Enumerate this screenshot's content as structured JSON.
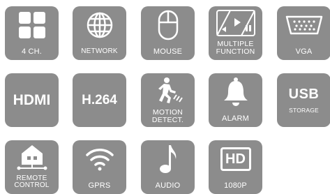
{
  "icons": {
    "four_ch": {
      "label": "4 CH.",
      "icon": "quad-grid-icon"
    },
    "network": {
      "label": "NETWORK",
      "icon": "globe-icon"
    },
    "mouse": {
      "label": "MOUSE",
      "icon": "mouse-icon"
    },
    "multiple_function": {
      "label": "MULTIPLE\nFUNCTION",
      "icon": "playback-icon"
    },
    "vga": {
      "label": "VGA",
      "icon": "vga-port-icon"
    },
    "hdmi": {
      "label": "HDMI"
    },
    "h264": {
      "label": "H.264"
    },
    "motion_detect": {
      "label": "MOTION\nDETECT.",
      "icon": "running-person-icon"
    },
    "alarm": {
      "label": "ALARM",
      "icon": "bell-icon"
    },
    "usb_storage": {
      "title": "USB",
      "label": "STORAGE"
    },
    "remote_control": {
      "label": "REMOTE\nCONTROL",
      "icon": "home-network-icon"
    },
    "gprs": {
      "label": "GPRS",
      "icon": "wifi-icon"
    },
    "audio": {
      "label": "AUDIO",
      "icon": "music-note-icon"
    },
    "hd1080p": {
      "title": "HD",
      "label": "1080P",
      "icon": "hd-badge-icon"
    }
  },
  "colors": {
    "tile": "#8c8c8c",
    "foreground": "#ffffff"
  }
}
